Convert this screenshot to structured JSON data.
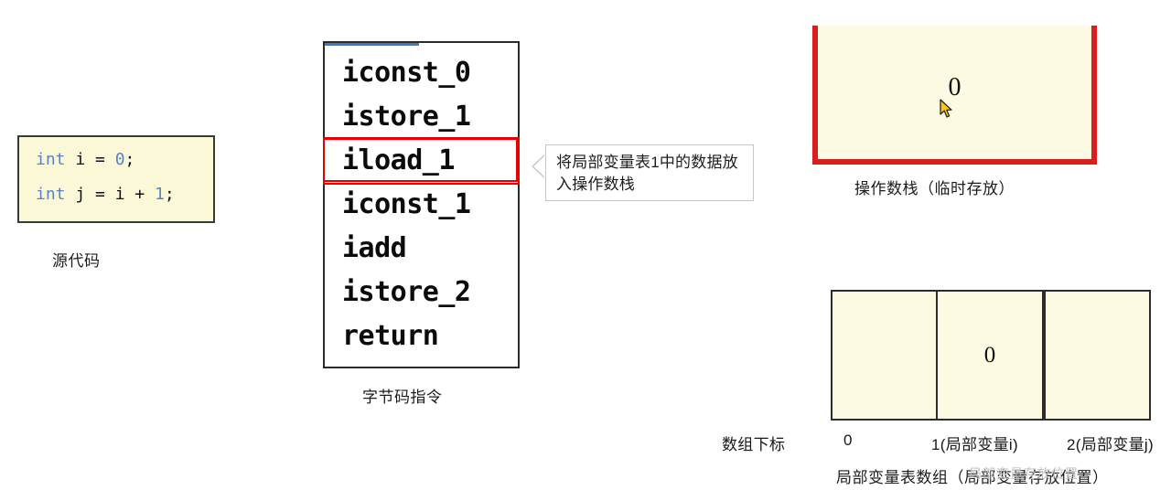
{
  "source_code": {
    "caption": "源代码",
    "lines": [
      {
        "keyword": "int",
        "body": " i = ",
        "value": "0",
        "tail": ";"
      },
      {
        "keyword": "int",
        "body": " j = i + ",
        "value": "1",
        "tail": ";"
      }
    ]
  },
  "bytecode": {
    "caption": "字节码指令",
    "instructions": [
      {
        "text": "iconst_0",
        "highlighted": false
      },
      {
        "text": "istore_1",
        "highlighted": false
      },
      {
        "text": "iload_1",
        "highlighted": true
      },
      {
        "text": "iconst_1",
        "highlighted": false
      },
      {
        "text": "iadd",
        "highlighted": false
      },
      {
        "text": "istore_2",
        "highlighted": false
      },
      {
        "text": "return",
        "highlighted": false
      }
    ]
  },
  "callout": {
    "text": "将局部变量表1中的数据放入操作数栈"
  },
  "operand_stack": {
    "caption": "操作数栈（临时存放）",
    "value": "0"
  },
  "local_variable_table": {
    "caption": "局部变量表数组（局部变量存放位置）",
    "index_label": "数组下标",
    "cells": [
      {
        "value": "",
        "index_label": "0"
      },
      {
        "value": "0",
        "index_label": "1(局部变量i)"
      },
      {
        "value": "",
        "index_label": "2(局部变量j)"
      }
    ]
  },
  "watermark": {
    "text": "局部变量存放位置"
  },
  "colors": {
    "highlight_red": "#e60000",
    "stack_red": "#d81e1e",
    "code_bg": "#fbf8d8",
    "cell_bg": "#fdfae4",
    "keyword_blue": "#5b84c4",
    "progress_blue": "#4178be"
  }
}
